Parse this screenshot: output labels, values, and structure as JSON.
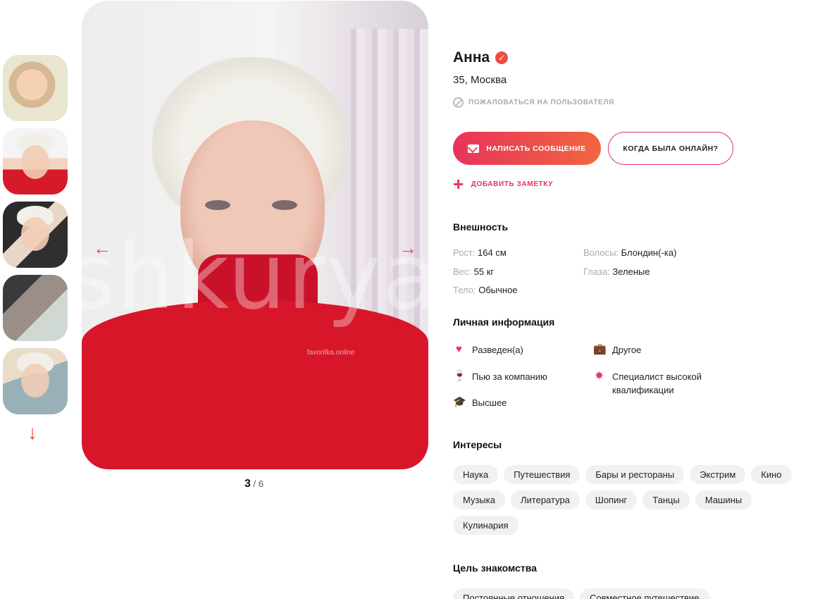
{
  "gallery": {
    "current": "3",
    "separator": "/",
    "total": "6",
    "watermark": "shkuryau",
    "watermark_small": "favoritka.online",
    "prev_icon": "←",
    "next_icon": "→",
    "down_icon": "↓"
  },
  "profile": {
    "name": "Анна",
    "verified_icon": "✓",
    "age_city": "35, Москва",
    "report_label": "ПОЖАЛОВАТЬСЯ НА ПОЛЬЗОВАТЕЛЯ",
    "message_button": "НАПИСАТЬ СООБЩЕНИЕ",
    "online_button": "КОГДА БЫЛА ОНЛАЙН?",
    "add_note": "ДОБАВИТЬ ЗАМЕТКУ"
  },
  "appearance": {
    "title": "Внешность",
    "height_k": "Рост:",
    "height_v": "164 см",
    "weight_k": "Вес:",
    "weight_v": "55 кг",
    "body_k": "Тело:",
    "body_v": "Обычное",
    "hair_k": "Волосы:",
    "hair_v": "Блондин(-ка)",
    "eyes_k": "Глаза:",
    "eyes_v": "Зеленые"
  },
  "personal": {
    "title": "Личная информация",
    "items": [
      {
        "icon": "♥",
        "text": "Разведен(а)"
      },
      {
        "icon": "🍷",
        "text": "Пью за компанию"
      },
      {
        "icon": "🎓",
        "text": "Высшее"
      },
      {
        "icon": "💼",
        "text": "Другое"
      },
      {
        "icon": "✸",
        "text": "Специалист высокой"
      },
      {
        "icon": "",
        "text": "квалификации"
      }
    ]
  },
  "interests": {
    "title": "Интересы",
    "tags": [
      "Наука",
      "Путешествия",
      "Бары и рестораны",
      "Экстрим",
      "Кино",
      "Музыка",
      "Литература",
      "Шопинг",
      "Танцы",
      "Машины",
      "Кулинария"
    ]
  },
  "goal": {
    "title": "Цель знакомства",
    "tags": [
      "Постоянные отношения",
      "Совместное путешествие"
    ]
  },
  "colors": {
    "accent": "#e8335b",
    "accent2": "#f0663f"
  }
}
